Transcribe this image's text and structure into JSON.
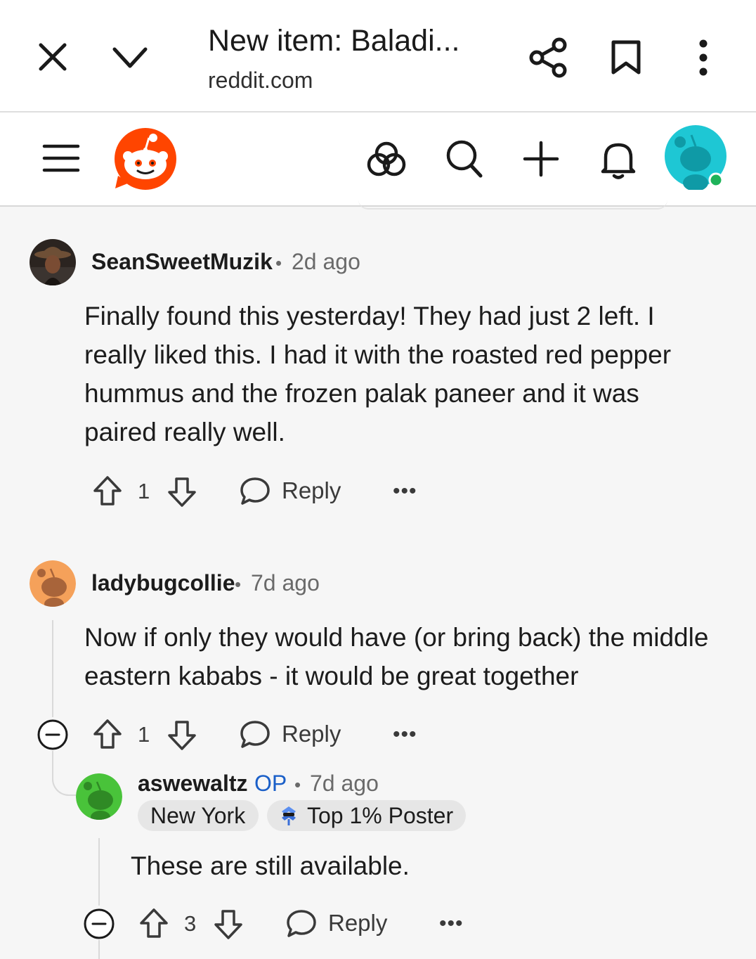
{
  "browser": {
    "title": "New item: Baladi...",
    "url": "reddit.com",
    "icons": [
      "close-icon",
      "chevron-down-icon",
      "share-icon",
      "bookmark-icon",
      "more-vert-icon"
    ]
  },
  "nav": {
    "icons": [
      "menu-icon",
      "reddit-logo",
      "communities-icon",
      "search-icon",
      "create-icon",
      "notifications-icon",
      "profile-avatar"
    ]
  },
  "comments": [
    {
      "username": "SeanSweetMuzik",
      "separator": "•",
      "time": "2d ago",
      "body": "Finally found this yesterday! They had just 2 left. I really liked this. I had it with the roasted red pepper hummus and the frozen palak paneer and it was paired really well.",
      "votes": "1",
      "reply_label": "Reply",
      "more_label": "•••"
    },
    {
      "username": "ladybugcollie",
      "separator": "•",
      "time": "7d ago",
      "body": "Now if only they would have (or bring back) the middle eastern kababs - it would be great together",
      "votes": "1",
      "reply_label": "Reply",
      "more_label": "•••"
    },
    {
      "username": "aswewaltz",
      "op_label": "OP",
      "separator": "•",
      "time": "7d ago",
      "flairs": [
        "New York",
        "Top 1% Poster"
      ],
      "body": "These are still available.",
      "votes": "3",
      "reply_label": "Reply",
      "more_label": "•••"
    }
  ],
  "colors": {
    "reddit_orange": "#ff4500",
    "op_blue": "#1a5fc8",
    "online_green": "#1fb35a",
    "avatar_teal": "#1ec7d4"
  }
}
